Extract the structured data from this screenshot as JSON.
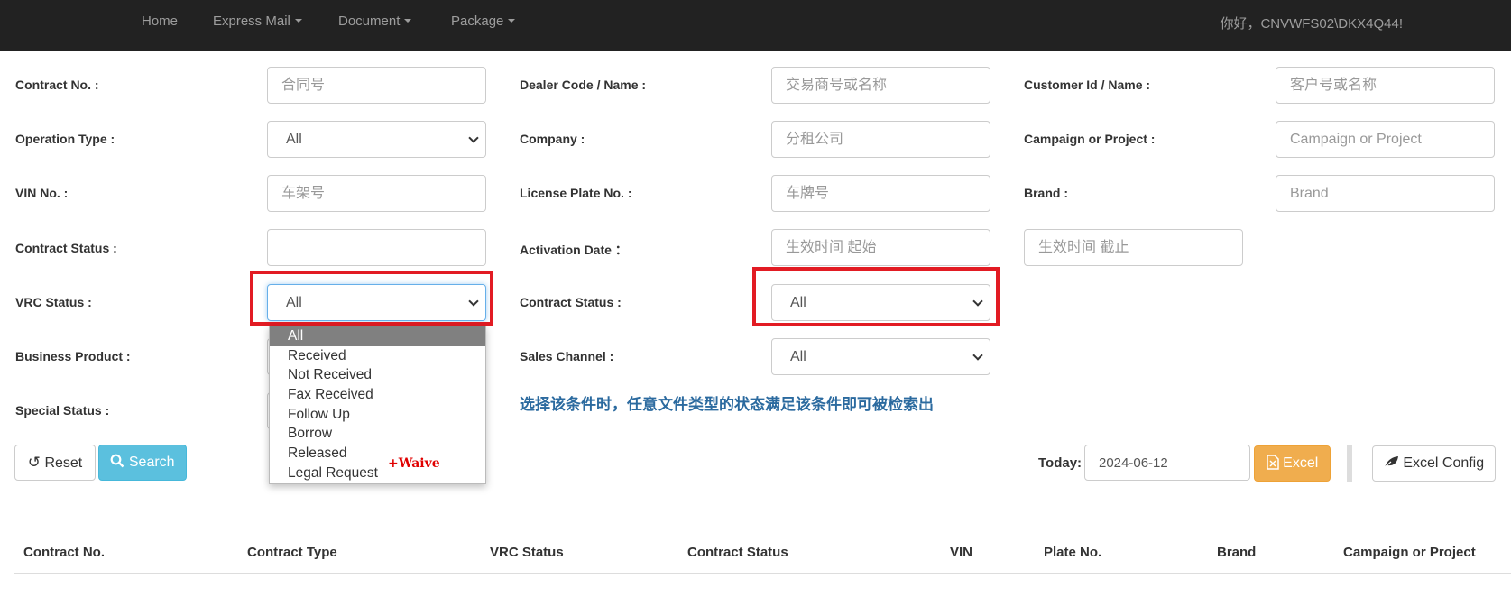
{
  "nav": {
    "home": "Home",
    "express_mail": "Express Mail",
    "document": "Document",
    "package": "Package",
    "greeting": "你好，CNVWFS02\\DKX4Q44!"
  },
  "filters": {
    "contract_no": {
      "label": "Contract No. :",
      "placeholder": "合同号"
    },
    "dealer": {
      "label": "Dealer Code / Name :",
      "placeholder": "交易商号或名称"
    },
    "customer": {
      "label": "Customer Id / Name :",
      "placeholder": "客户号或名称"
    },
    "operation_type": {
      "label": "Operation Type :",
      "value": "All"
    },
    "company": {
      "label": "Company :",
      "placeholder": "分租公司"
    },
    "campaign": {
      "label": "Campaign or Project :",
      "placeholder": "Campaign or Project"
    },
    "vin": {
      "label": "VIN No. :",
      "placeholder": "车架号"
    },
    "license_plate": {
      "label": "License Plate No. :",
      "placeholder": "车牌号"
    },
    "brand": {
      "label": "Brand :",
      "placeholder": "Brand"
    },
    "contract_status_top": {
      "label": "Contract Status :",
      "value": ""
    },
    "activation_date": {
      "label": "Activation Date ：",
      "start_placeholder": "生效时间 起始",
      "end_placeholder": "生效时间 截止"
    },
    "vrc_status": {
      "label": "VRC Status :",
      "value": "All"
    },
    "contract_status": {
      "label": "Contract Status :",
      "value": "All"
    },
    "business_product": {
      "label": "Business Product :"
    },
    "sales_channel": {
      "label": "Sales Channel :",
      "value": "All"
    },
    "special_status": {
      "label": "Special Status :"
    }
  },
  "vrc_dropdown": {
    "options": [
      "All",
      "Received",
      "Not Received",
      "Fax Received",
      "Follow Up",
      "Borrow",
      "Released",
      "Legal Request"
    ],
    "selected": "All"
  },
  "annotation_waive": "+Waive",
  "note_cn": "选择该条件时，任意文件类型的状态满足该条件即可被检索出",
  "actions": {
    "reset": "Reset",
    "search": "Search",
    "today_label": "Today:",
    "today_value": "2024-06-12",
    "excel": "Excel",
    "excel_config": "Excel Config"
  },
  "table": {
    "headers": [
      "Contract No.",
      "Contract Type",
      "VRC Status",
      "Contract Status",
      "VIN",
      "Plate No.",
      "Brand",
      "Campaign or Project"
    ]
  },
  "colors": {
    "navbar": "#222222",
    "highlight_red": "#e21b23",
    "note_blue": "#2b6a9f",
    "search_button": "#5bc0de",
    "excel_button": "#f0ad4e"
  }
}
